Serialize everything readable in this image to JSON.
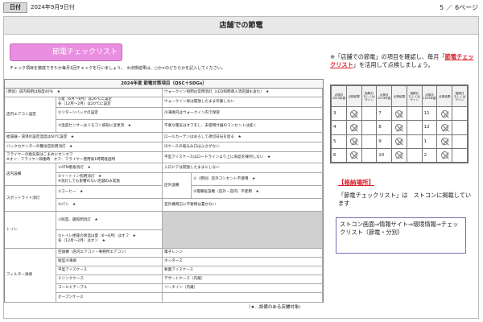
{
  "header": {
    "date_label": "日付",
    "date_value": "2024年9月9日付",
    "page_current": "5",
    "page_sep": "／",
    "page_total": "6ページ"
  },
  "title": "店舗での節電",
  "checklist_button": "節電チェックリスト",
  "instruction": "チェック項目を徹底できたか毎月1回チェックを行いましょう。　※点検結果は、○か×のどちらかを記入してください。",
  "table": {
    "title": "2024年度 節電対策項目（QSC＋SDGs）",
    "c": {
      "r0a": "(原則）店内照明は照度40％　★",
      "r0b": "ウォークイン照明は常時消灯（LED照明導入済店舗も含む）　★",
      "ac_cat": "店内エアコン設定",
      "ac1a": "①夏（6月～8月）は26℃に設定",
      "ac1b": "冬（12月～2月）は20℃に設定",
      "ac2": "②リターンバックの設定",
      "ac3": "③温度センサーはリモコン感知に変更済　★",
      "r1b": "ウォークイン扉は開放したまま作業しない",
      "r2b": "冷凍庫内はウォークイン内で保管",
      "r3b": "不要な電気はオフをし、未使用什器のコンセントは抜く",
      "r4a": "給湯器・湯沸の設定温度は60℃設定　★",
      "r4b": "ロールカーテンはおろして適切日光を遮る　★",
      "r5a": "バックカウンターの穫早店照明消灯　★",
      "r5b": "冷ケースの吸込み口はふさがない",
      "r6a1": "フライヤーの換気扇はこまめにオンオフ",
      "r6a2": "※オン：フライヤー稼働時　オフ：フライヤー使用後1時間経過時",
      "r6b": "平型アイスケースはロードラインより上に商品を陳列しない　★",
      "ins_cat": "店内設備",
      "ins1": "①ATM看板消灯　★",
      "ins2a": "②イートイン照明消灯　★",
      "ins2b": "※消灯しても影響のない店舗のみ実施",
      "r7b": "入口ドアは開放したままにしない",
      "out_cat": "店外設備",
      "out1": "①（原則）店外コンセント不使用　★",
      "out2": "②電撃殺虫機（店外・店内）不使用　★",
      "spot_cat": "スポットライト消灯",
      "spot1": "①コーヒー　★",
      "spot2": "②パン　★",
      "r9b": "室外機周辺に不要物は置かない",
      "toilet_cat": "トイレ",
      "t1": "①照室、鏡照明消灯　★",
      "t2a": "②トイレ便座の保温は夏（6～8月）はオフ　★",
      "t2b": "冬（12月～2月）はオン　★",
      "filter_cat": "フィルター清掃",
      "f1a": "空調機（店内エアコン・事務所エアコン）",
      "f1b": "電子レンジ",
      "f2a": "縦型冷凍庫",
      "f2b": "ホッターズ",
      "f3a": "平型アイスケース",
      "f3b": "要面アイスケース",
      "f4a": "ドリンクケース",
      "f4b": "デザートケース（内蔵）",
      "f5a": "コールドテーブル",
      "f5b": "リーチイン（内蔵）",
      "f6a": "オープンケース"
    },
    "footnote": "（★…設備のある店舗対象)"
  },
  "right": {
    "para_1": "※「店舗での節電」の項目を確認し、毎月「",
    "para_highlight": "節電チェックリスト",
    "para_2": "」を活用して点検しましょう。",
    "grid": {
      "hdr_a": [
        "点検月",
        "2023年度"
      ],
      "hdr_b": [
        "点検結果"
      ],
      "hdr_c": [
        "指摘日",
        "もしくは",
        "サイン"
      ],
      "rows": [
        [
          "3",
          "7",
          "11"
        ],
        [
          "4",
          "8",
          "12"
        ],
        [
          "5",
          "9",
          "1"
        ],
        [
          "6",
          "10",
          "2"
        ]
      ]
    },
    "loc_title": "【格納場所】",
    "loc_text": "「節電チェックリスト」は　ストコンに掲載しています",
    "loc_box": "ストコン画面⇒情報サイト⇒環境情報⇒チェックリスト（節電・分別）"
  }
}
